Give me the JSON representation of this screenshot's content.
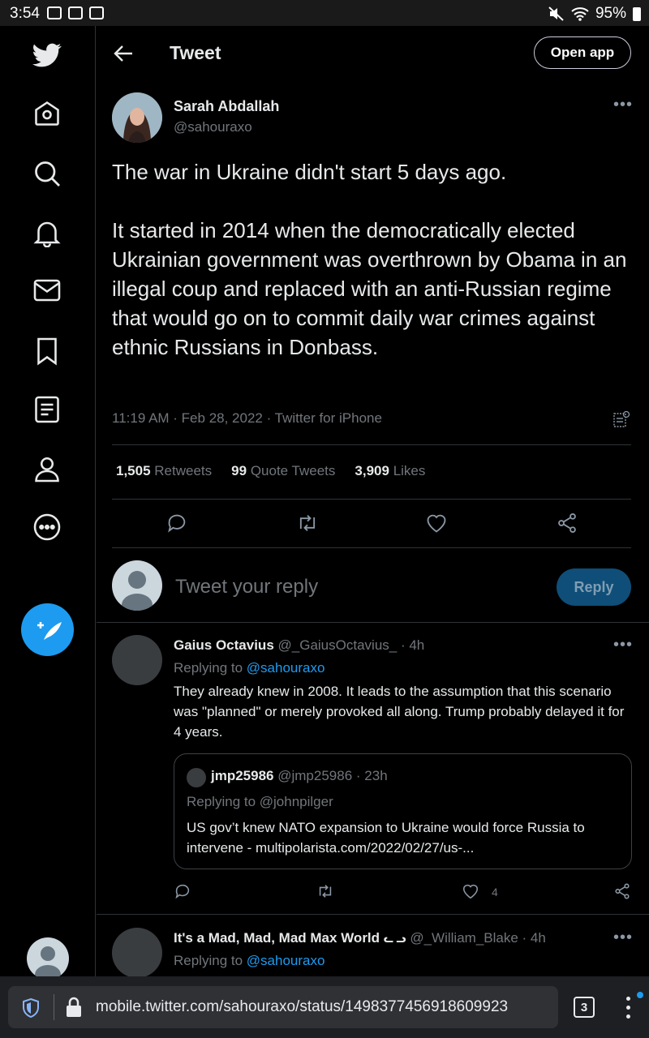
{
  "status_bar": {
    "time": "3:54",
    "battery": "95%"
  },
  "header": {
    "title": "Tweet",
    "open_app": "Open app"
  },
  "tweet": {
    "author_name": "Sarah Abdallah",
    "author_handle": "@sahouraxo",
    "text": "The war in Ukraine didn't start 5 days ago.\n\nIt started in 2014 when the democratically elected Ukrainian government was overthrown by Obama in an illegal coup and replaced with an anti-Russian regime that would go on to commit daily war crimes against ethnic Russians in Donbass.",
    "meta": "11:19 AM · Feb 28, 2022 · Twitter for iPhone",
    "retweets_count": "1,505",
    "retweets_label": "Retweets",
    "quotes_count": "99",
    "quotes_label": "Quote Tweets",
    "likes_count": "3,909",
    "likes_label": "Likes"
  },
  "reply_box": {
    "placeholder": "Tweet your reply",
    "button": "Reply"
  },
  "replies": [
    {
      "name": "Gaius Octavius",
      "handle": "@_GaiusOctavius_",
      "time": "· 4h",
      "replying_prefix": "Replying to",
      "replying_to": "@sahouraxo",
      "text": "They already knew in 2008. It leads to the assumption that this scenario was \"planned\" or merely provoked all along. Trump probably delayed it for 4 years.",
      "likes": "4",
      "quote": {
        "name": "jmp25986",
        "handle": "@jmp25986",
        "time": "· 23h",
        "replying": "Replying to @johnpilger",
        "text": "US gov’t knew NATO expansion to Ukraine would force Russia to intervene - multipolarista.com/2022/02/27/us-..."
      }
    },
    {
      "name": "It's a Mad, Mad, Mad Max World",
      "name_suffix": "ᓚ ᓗ",
      "handle": "@_William_Blake",
      "time": "· 4h",
      "replying_prefix": "Replying to",
      "replying_to": "@sahouraxo"
    }
  ],
  "browser": {
    "url": "mobile.twitter.com/sahouraxo/status/1498377456918609923",
    "tab_count": "3"
  },
  "colors": {
    "accent": "#1d9bf0",
    "background": "#000000",
    "muted": "#71767b"
  },
  "icons": [
    "twitter-logo-icon",
    "home-icon",
    "search-icon",
    "bell-icon",
    "mail-icon",
    "bookmark-icon",
    "lists-icon",
    "profile-icon",
    "more-circle-icon",
    "compose-icon",
    "back-arrow-icon",
    "more-dots-icon",
    "reply-icon",
    "retweet-icon",
    "like-icon",
    "share-icon",
    "shield-icon",
    "lock-icon",
    "menu-dots-icon"
  ]
}
